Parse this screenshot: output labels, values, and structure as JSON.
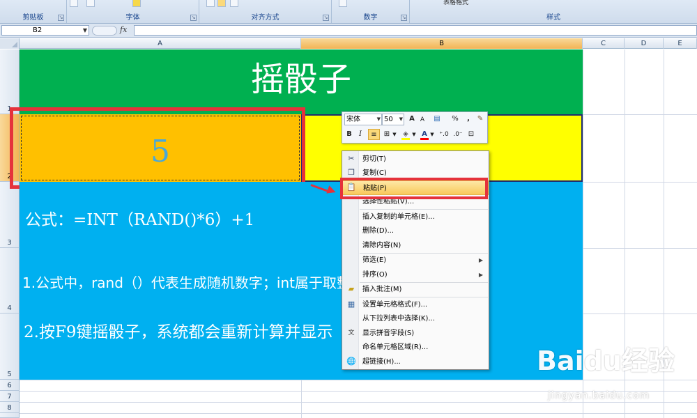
{
  "ribbon": {
    "groups": [
      {
        "label": "剪贴板"
      },
      {
        "label": "字体"
      },
      {
        "label": "对齐方式"
      },
      {
        "label": "数字"
      },
      {
        "label": "样式"
      }
    ],
    "table_format_label": "表格格式"
  },
  "formula_bar": {
    "name_box": "B2",
    "fx_label": "fx",
    "value": ""
  },
  "columns": [
    "A",
    "B",
    "C",
    "D",
    "E"
  ],
  "rows": [
    "1",
    "2",
    "3",
    "4",
    "5",
    "6",
    "7",
    "8",
    "9"
  ],
  "sheet": {
    "title": "摇骰子",
    "dice_value": "5",
    "formula_text": "公式：=INT（RAND()*6）+1",
    "note1": "1.公式中，rand（）代表生成随机数字；int属于取整数",
    "note2": "2.按F9键摇骰子，系统都会重新计算并显示"
  },
  "mini_toolbar": {
    "font": "宋体",
    "size": "50",
    "grow_font": "A",
    "shrink_font": "A",
    "percent": "%",
    "comma": ",",
    "bold": "B",
    "italic": "I",
    "font_color_letter": "A"
  },
  "context_menu": {
    "items": [
      {
        "label": "剪切(T)",
        "icon": "scissors-icon"
      },
      {
        "label": "复制(C)",
        "icon": "copy-icon"
      },
      {
        "label": "粘贴(P)",
        "icon": "paste-icon"
      },
      {
        "label": "选择性粘贴(V)..."
      },
      {
        "label": "插入复制的单元格(E)..."
      },
      {
        "label": "删除(D)..."
      },
      {
        "label": "清除内容(N)"
      },
      {
        "label": "筛选(E)",
        "submenu": true
      },
      {
        "label": "排序(O)",
        "submenu": true
      },
      {
        "label": "插入批注(M)",
        "icon": "comment-icon"
      },
      {
        "label": "设置单元格格式(F)...",
        "icon": "format-cells-icon"
      },
      {
        "label": "从下拉列表中选择(K)..."
      },
      {
        "label": "显示拼音字段(S)",
        "icon": "phonetic-icon"
      },
      {
        "label": "命名单元格区域(R)..."
      },
      {
        "label": "超链接(H)...",
        "icon": "hyperlink-icon"
      }
    ]
  },
  "watermark": {
    "brand": "Baidu经验",
    "url": "jingyan.baidu.com"
  },
  "colors": {
    "title_bg": "#00b050",
    "a2_bg": "#ffc000",
    "b2_bg": "#ffff00",
    "note_bg": "#00b0f0",
    "highlight_red": "#e5323b"
  }
}
